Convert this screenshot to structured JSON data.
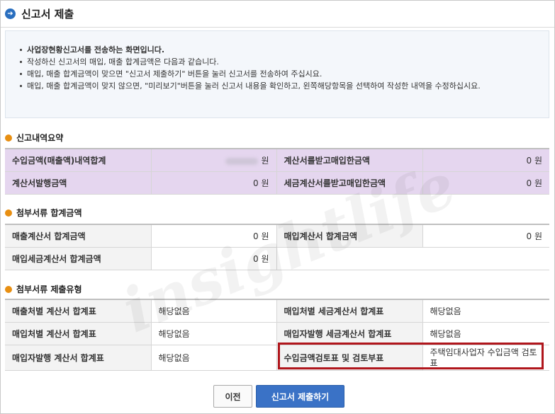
{
  "header": {
    "title": "신고서 제출",
    "icon": "arrow-circle-icon"
  },
  "notice": {
    "lines": [
      "사업장현황신고서를 전송하는 화면입니다.",
      "작성하신 신고서의 매입, 매출 합계금액은 다음과 같습니다.",
      "매입, 매출 합계금액이 맞으면 \"신고서 제출하기\" 버튼을 눌러 신고서를 전송하여 주십시요.",
      "매입, 매출 합계금액이 맞지 않으면, \"미리보기\"버튼을 눌러 신고서 내용을 확인하고, 왼쪽해당항목을 선택하여 작성한 내역을 수정하십시요."
    ]
  },
  "summary": {
    "title": "신고내역요약",
    "rows": [
      {
        "l1": "수입금액(매출액)내역합계",
        "v1": "원",
        "l2": "계산서를받고매입한금액",
        "v2": "0 원"
      },
      {
        "l1": "계산서발행금액",
        "v1": "0 원",
        "l2": "세금계산서를받고매입한금액",
        "v2": "0 원"
      }
    ]
  },
  "attach_total": {
    "title": "첨부서류 합계금액",
    "rows": [
      {
        "l1": "매출계산서 합계금액",
        "v1": "0 원",
        "l2": "매입계산서 합계금액",
        "v2": "0 원"
      },
      {
        "l1": "매입세금계산서 합계금액",
        "v1": "0 원"
      }
    ]
  },
  "attach_type": {
    "title": "첨부서류 제출유형",
    "rows": [
      {
        "l1": "매출처별 계산서 합계표",
        "v1": "해당없음",
        "l2": "매입처별 세금계산서 합계표",
        "v2": "해당없음"
      },
      {
        "l1": "매입처별 계산서 합계표",
        "v1": "해당없음",
        "l2": "매입자발행 세금계산서 합계표",
        "v2": "해당없음"
      },
      {
        "l1": "매입자발행 계산서 합계표",
        "v1": "해당없음",
        "l2": "수입금액검토표 및 검토부표",
        "v2": "주택임대사업자 수입금액 검토표"
      }
    ]
  },
  "buttons": {
    "prev": "이전",
    "submit": "신고서 제출하기"
  },
  "watermark": "insightlife",
  "colors": {
    "accent": "#3a72c6",
    "section_icon": "#e88f12",
    "highlight": "#b0161c",
    "summary_bg": "#e5d6ef"
  }
}
